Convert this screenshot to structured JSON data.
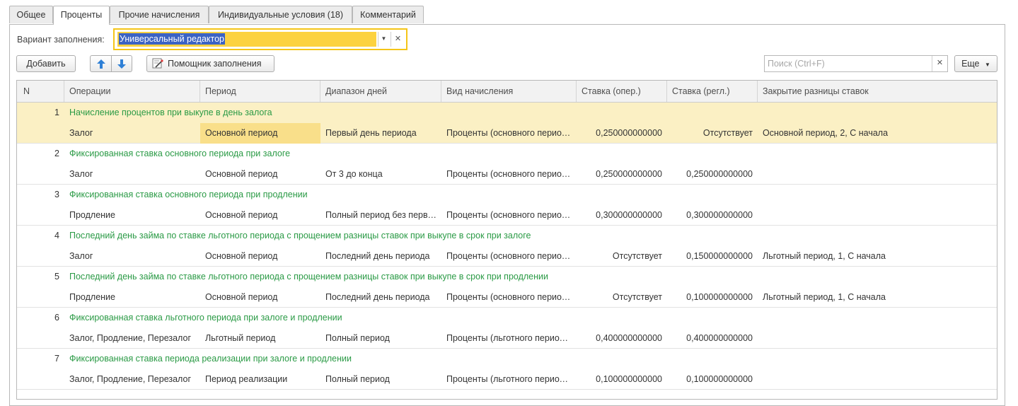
{
  "tabs": [
    {
      "label": "Общее",
      "active": false
    },
    {
      "label": "Проценты",
      "active": true
    },
    {
      "label": "Прочие начисления",
      "active": false
    },
    {
      "label": "Индивидуальные условия (18)",
      "active": false
    },
    {
      "label": "Комментарий",
      "active": false
    }
  ],
  "fill_variant": {
    "label": "Вариант заполнения:",
    "value": "Универсальный редактор"
  },
  "toolbar": {
    "add_label": "Добавить",
    "move_up_icon": "arrow-up-icon",
    "move_down_icon": "arrow-down-icon",
    "assistant_label": "Помощник заполнения",
    "search_placeholder": "Поиск (Ctrl+F)",
    "more_label": "Еще"
  },
  "colors": {
    "accent_yellow": "#f5c518",
    "selected_row": "#fbf0c4",
    "current_cell": "#f9df8a",
    "title_green": "#2a9a45",
    "arrow_blue": "#2f80d6"
  },
  "table": {
    "columns": [
      "N",
      "Операции",
      "Период",
      "Диапазон дней",
      "Вид начисления",
      "Ставка (опер.)",
      "Ставка (регл.)",
      "Закрытие разницы ставок"
    ],
    "rows": [
      {
        "n": "1",
        "title": "Начисление процентов при выкупе в день залога",
        "operations": "Залог",
        "period": "Основной период",
        "days": "Первый день периода",
        "kind": "Проценты (основного периода)",
        "rate_op": "0,250000000000",
        "rate_reg": "Отсутствует",
        "closing": "Основной период, 2, С начала"
      },
      {
        "n": "2",
        "title": "Фиксированная ставка основного периода при залоге",
        "operations": "Залог",
        "period": "Основной период",
        "days": "От 3 до конца",
        "kind": "Проценты (основного периода)",
        "rate_op": "0,250000000000",
        "rate_reg": "0,250000000000",
        "closing": ""
      },
      {
        "n": "3",
        "title": "Фиксированная ставка основного периода при продлении",
        "operations": "Продление",
        "period": "Основной период",
        "days": "Полный период без первого дня",
        "kind": "Проценты (основного периода)",
        "rate_op": "0,300000000000",
        "rate_reg": "0,300000000000",
        "closing": ""
      },
      {
        "n": "4",
        "title": "Последний день займа по ставке льготного периода с прощением разницы ставок при выкупе в срок при залоге",
        "operations": "Залог",
        "period": "Основной период",
        "days": "Последний день периода",
        "kind": "Проценты (основного периода)",
        "rate_op": "Отсутствует",
        "rate_reg": "0,150000000000",
        "closing": "Льготный период, 1, С начала"
      },
      {
        "n": "5",
        "title": "Последний день займа по ставке льготного периода с прощением разницы ставок при выкупе в срок при продлении",
        "operations": "Продление",
        "period": "Основной период",
        "days": "Последний день периода",
        "kind": "Проценты (основного периода)",
        "rate_op": "Отсутствует",
        "rate_reg": "0,100000000000",
        "closing": "Льготный период, 1, С начала"
      },
      {
        "n": "6",
        "title": "Фиксированная ставка льготного периода при залоге и продлении",
        "operations": "Залог, Продление, Перезалог",
        "period": "Льготный период",
        "days": "Полный период",
        "kind": "Проценты (льготного периода)",
        "rate_op": "0,400000000000",
        "rate_reg": "0,400000000000",
        "closing": ""
      },
      {
        "n": "7",
        "title": "Фиксированная ставка периода реализации при залоге и продлении",
        "operations": "Залог, Продление, Перезалог",
        "period": "Период реализации",
        "days": "Полный период",
        "kind": "Проценты (льготного периода)",
        "rate_op": "0,100000000000",
        "rate_reg": "0,100000000000",
        "closing": ""
      }
    ]
  }
}
